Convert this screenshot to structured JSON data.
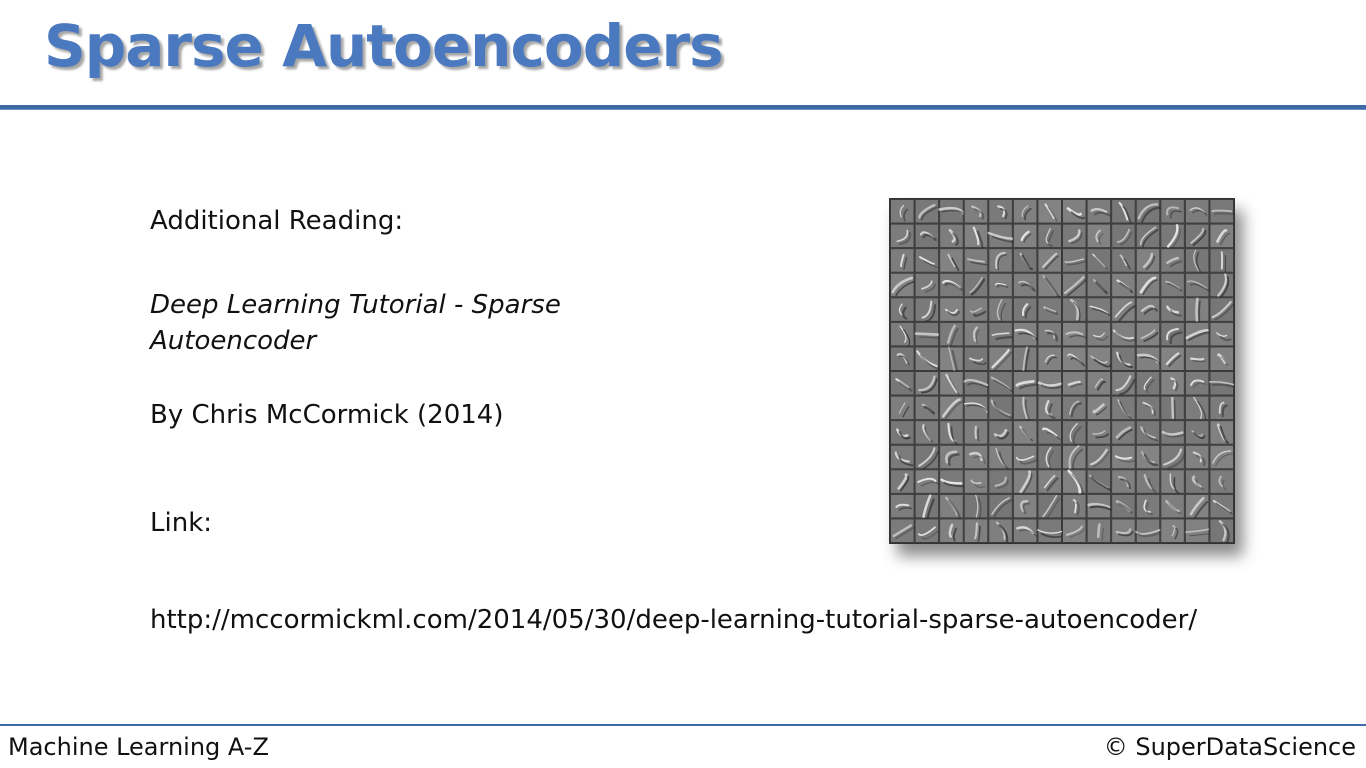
{
  "slide": {
    "title": "Sparse Autoencoders",
    "additional_reading_label": "Additional Reading:",
    "tutorial_title": "Deep Learning Tutorial - Sparse Autoencoder",
    "author": "By Chris McCormick (2014)",
    "link_label": "Link:",
    "url": "http://mccormickml.com/2014/05/30/deep-learning-tutorial-sparse-autoencoder/"
  },
  "figure": {
    "description_icon": "mnist-filter-grid-image",
    "grid_rows": 14,
    "grid_cols": 14
  },
  "footer": {
    "course": "Machine Learning A-Z",
    "copyright": "© SuperDataScience"
  },
  "colors": {
    "title": "#4a79bf",
    "rule": "#3e6aa6",
    "text": "#111111"
  }
}
